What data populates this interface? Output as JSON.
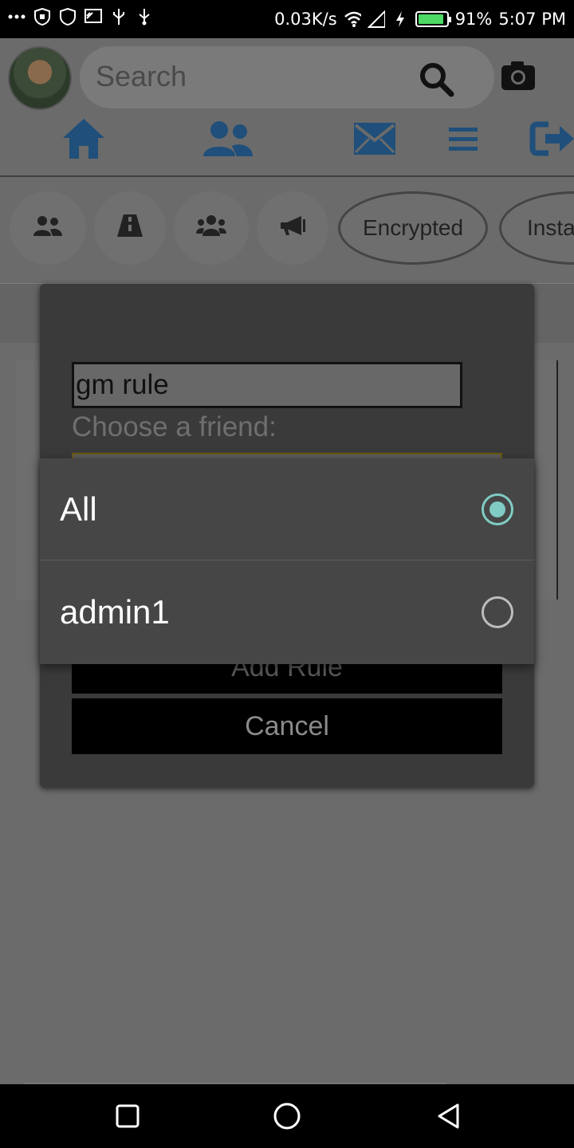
{
  "status_bar": {
    "network_speed": "0.03K/s",
    "battery_percent": "91%",
    "battery_level": 0.91,
    "time": "5:07 PM",
    "icons": [
      "more-icon",
      "shield-icon",
      "shield-outline-icon",
      "cast-icon",
      "usb-icon",
      "usb-icon-2",
      "wifi-icon",
      "signal-icon",
      "charging-icon",
      "battery-icon"
    ]
  },
  "header": {
    "search_placeholder": "Search",
    "icons": [
      "search-icon",
      "camera-icon"
    ]
  },
  "nav": {
    "items": [
      "home-icon",
      "friends-icon",
      "messages-icon",
      "menu-icon",
      "logout-icon"
    ]
  },
  "categories": {
    "chips": [
      {
        "icon": "users-icon",
        "label": ""
      },
      {
        "icon": "road-icon",
        "label": ""
      },
      {
        "icon": "group-icon",
        "label": ""
      },
      {
        "icon": "megaphone-icon",
        "label": ""
      },
      {
        "icon": "",
        "label": "Encrypted"
      },
      {
        "icon": "",
        "label": "Insta"
      }
    ]
  },
  "dialog": {
    "rule_name_value": "gm rule",
    "choose_label": "Choose a friend:",
    "add_rule_label": "Add Rule",
    "cancel_label": "Cancel"
  },
  "dropdown": {
    "options": [
      {
        "label": "All",
        "selected": true
      },
      {
        "label": "admin1",
        "selected": false
      }
    ]
  },
  "colors": {
    "accent_radio": "#80cbc4",
    "nav_icon_blue": "#1f4f7a",
    "battery_green": "#4cd964"
  }
}
